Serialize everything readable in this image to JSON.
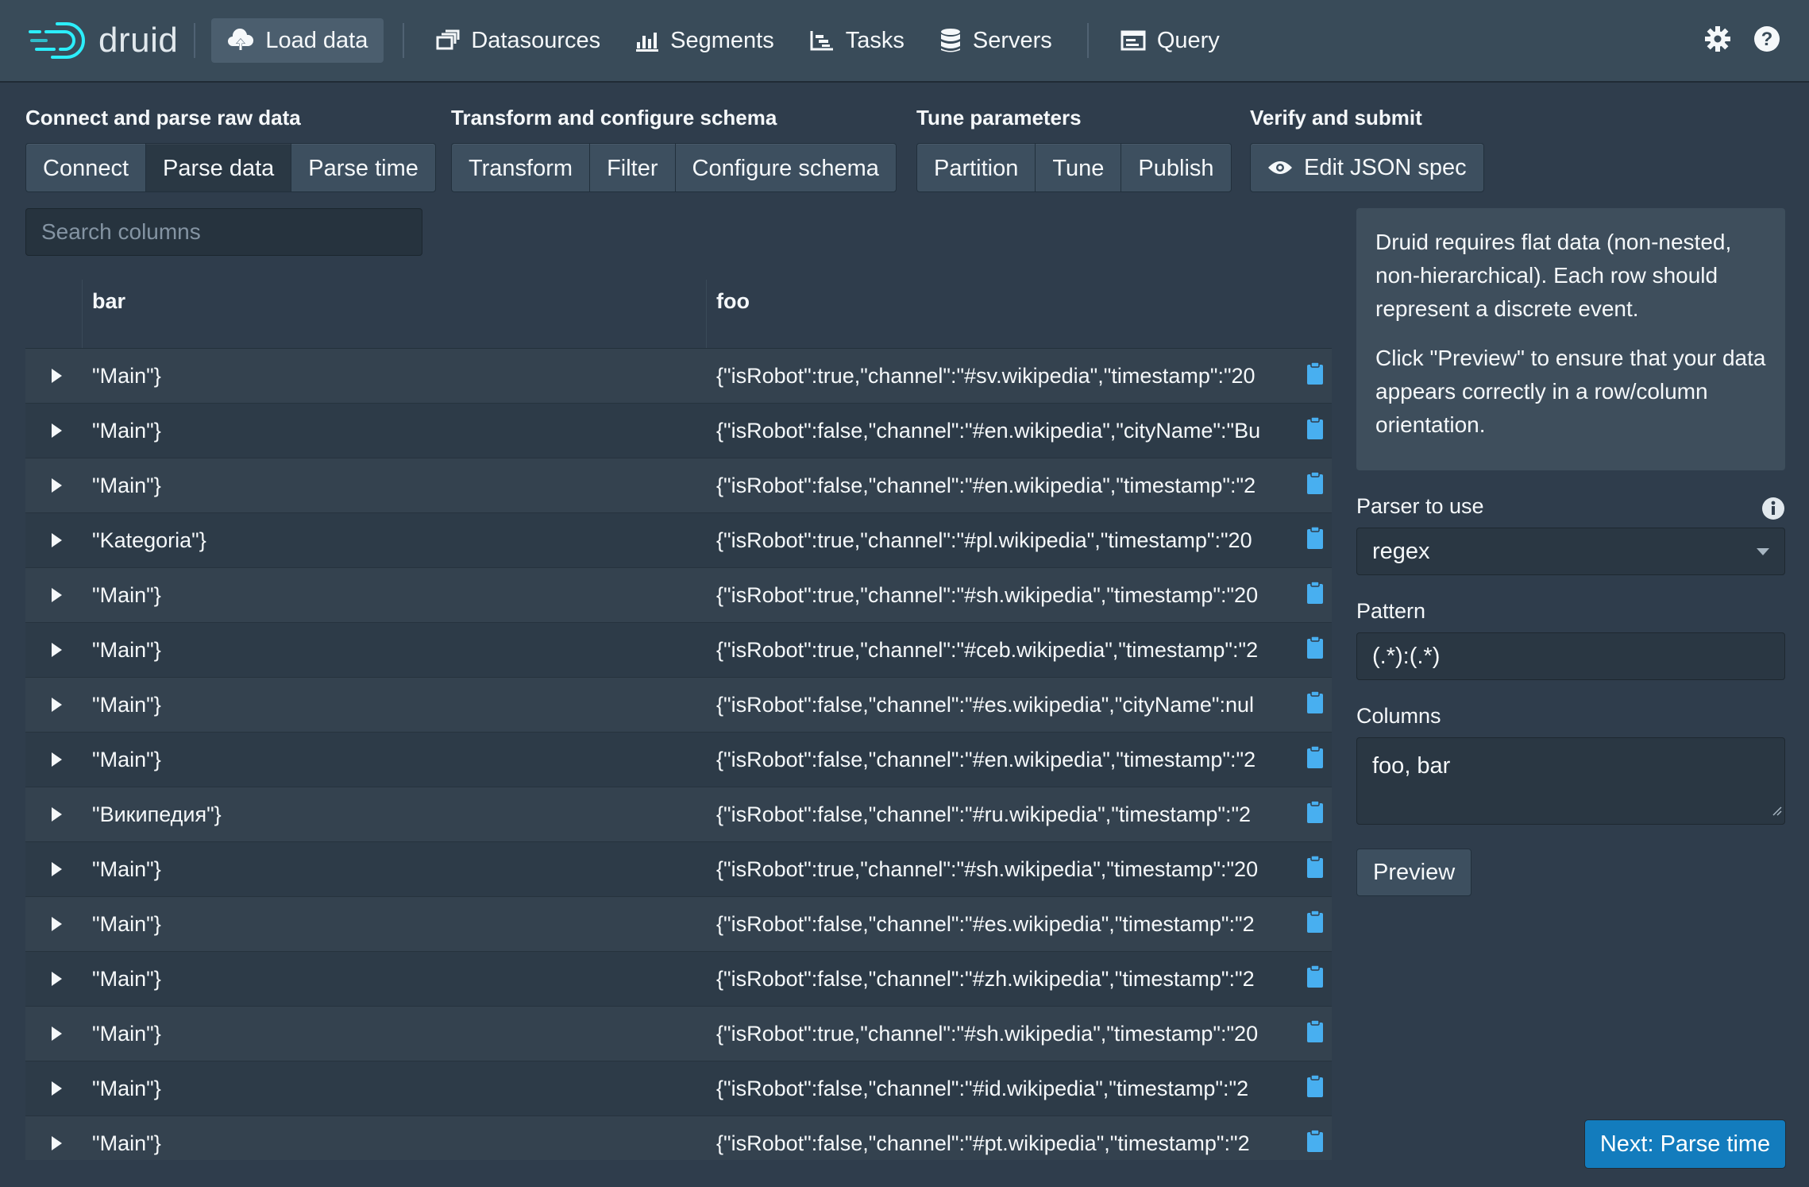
{
  "nav": {
    "logo_text": "druid",
    "items": [
      {
        "label": "Load data",
        "icon": "cloud-upload-icon",
        "active": true
      },
      {
        "label": "Datasources",
        "icon": "datasources-icon"
      },
      {
        "label": "Segments",
        "icon": "segments-icon"
      },
      {
        "label": "Tasks",
        "icon": "tasks-icon"
      },
      {
        "label": "Servers",
        "icon": "database-icon"
      },
      {
        "label": "Query",
        "icon": "query-icon"
      }
    ],
    "right_icons": [
      "gear-icon",
      "help-icon"
    ]
  },
  "steps": [
    {
      "title": "Connect and parse raw data",
      "buttons": [
        "Connect",
        "Parse data",
        "Parse time"
      ]
    },
    {
      "title": "Transform and configure schema",
      "buttons": [
        "Transform",
        "Filter",
        "Configure schema"
      ]
    },
    {
      "title": "Tune parameters",
      "buttons": [
        "Partition",
        "Tune",
        "Publish"
      ]
    },
    {
      "title": "Verify and submit",
      "buttons": [
        "Edit JSON spec"
      ]
    }
  ],
  "active_step": "Parse data",
  "search": {
    "placeholder": "Search columns",
    "value": ""
  },
  "table": {
    "columns": [
      "bar",
      "foo"
    ],
    "rows": [
      {
        "bar": "\"Main\"}",
        "foo": "{\"isRobot\":true,\"channel\":\"#sv.wikipedia\",\"timestamp\":\"20"
      },
      {
        "bar": "\"Main\"}",
        "foo": "{\"isRobot\":false,\"channel\":\"#en.wikipedia\",\"cityName\":\"Bu"
      },
      {
        "bar": "\"Main\"}",
        "foo": "{\"isRobot\":false,\"channel\":\"#en.wikipedia\",\"timestamp\":\"2"
      },
      {
        "bar": "\"Kategoria\"}",
        "foo": "{\"isRobot\":true,\"channel\":\"#pl.wikipedia\",\"timestamp\":\"20"
      },
      {
        "bar": "\"Main\"}",
        "foo": "{\"isRobot\":true,\"channel\":\"#sh.wikipedia\",\"timestamp\":\"20"
      },
      {
        "bar": "\"Main\"}",
        "foo": "{\"isRobot\":true,\"channel\":\"#ceb.wikipedia\",\"timestamp\":\"2"
      },
      {
        "bar": "\"Main\"}",
        "foo": "{\"isRobot\":false,\"channel\":\"#es.wikipedia\",\"cityName\":nul"
      },
      {
        "bar": "\"Main\"}",
        "foo": "{\"isRobot\":false,\"channel\":\"#en.wikipedia\",\"timestamp\":\"2"
      },
      {
        "bar": "\"Википедия\"}",
        "foo": "{\"isRobot\":false,\"channel\":\"#ru.wikipedia\",\"timestamp\":\"2"
      },
      {
        "bar": "\"Main\"}",
        "foo": "{\"isRobot\":true,\"channel\":\"#sh.wikipedia\",\"timestamp\":\"20"
      },
      {
        "bar": "\"Main\"}",
        "foo": "{\"isRobot\":false,\"channel\":\"#es.wikipedia\",\"timestamp\":\"2"
      },
      {
        "bar": "\"Main\"}",
        "foo": "{\"isRobot\":false,\"channel\":\"#zh.wikipedia\",\"timestamp\":\"2"
      },
      {
        "bar": "\"Main\"}",
        "foo": "{\"isRobot\":true,\"channel\":\"#sh.wikipedia\",\"timestamp\":\"20"
      },
      {
        "bar": "\"Main\"}",
        "foo": "{\"isRobot\":false,\"channel\":\"#id.wikipedia\",\"timestamp\":\"2"
      },
      {
        "bar": "\"Main\"}",
        "foo": "{\"isRobot\":false,\"channel\":\"#pt.wikipedia\",\"timestamp\":\"2"
      }
    ]
  },
  "info": {
    "p1": "Druid requires flat data (non-nested, non-hierarchical). Each row should represent a discrete event.",
    "p2": "Click \"Preview\" to ensure that your data appears correctly in a row/column orientation."
  },
  "form": {
    "parser_label": "Parser to use",
    "parser_value": "regex",
    "pattern_label": "Pattern",
    "pattern_value": "(.*):(.*)",
    "columns_label": "Columns",
    "columns_value": "foo, bar",
    "preview_label": "Preview"
  },
  "next_button": "Next: Parse time",
  "colors": {
    "accent": "#48aff0",
    "primary_button": "#137cbd",
    "clipboard": "#48aff0"
  }
}
